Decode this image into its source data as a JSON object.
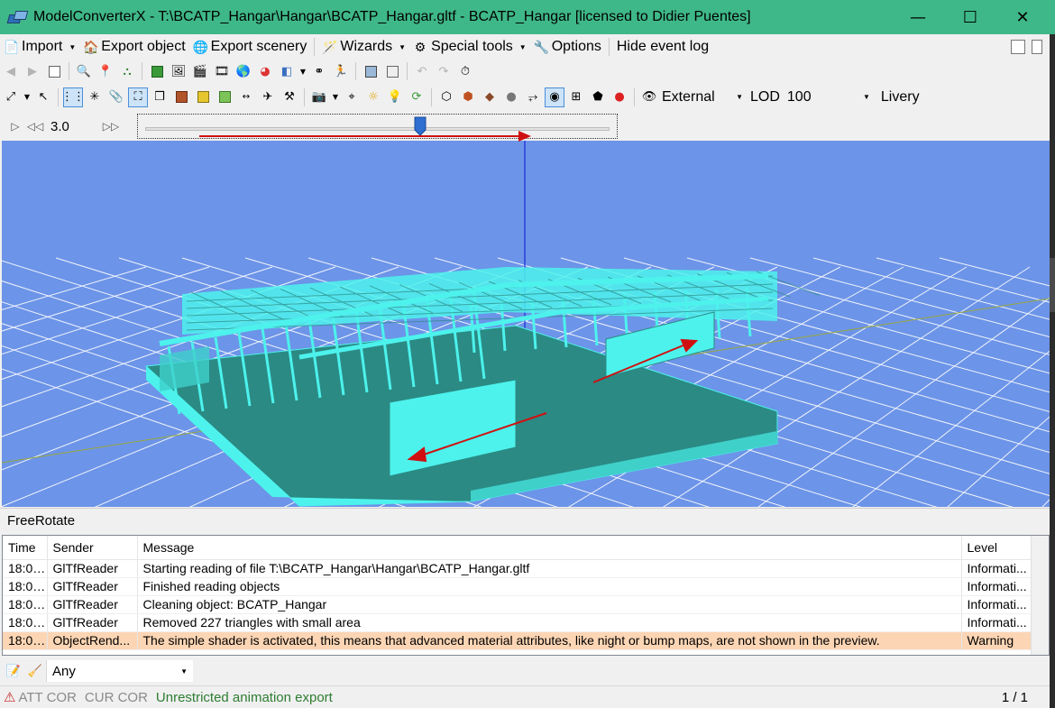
{
  "window": {
    "title": "ModelConverterX - T:\\BCATP_Hangar\\Hangar\\BCATP_Hangar.gltf - BCATP_Hangar [licensed to Didier Puentes]",
    "minimize_glyph": "—",
    "maximize_glyph": "☐",
    "close_glyph": "✕"
  },
  "menubar": {
    "import": "Import",
    "export_object": "Export object",
    "export_scenery": "Export scenery",
    "wizards": "Wizards",
    "special_tools": "Special tools",
    "options": "Options",
    "hide_event_log": "Hide event log"
  },
  "toolbar2": {
    "view_mode": "External",
    "lod_label": "LOD",
    "lod_value": "100",
    "livery_label": "Livery"
  },
  "animation": {
    "speed": "3.0",
    "slider_position": 0.59
  },
  "viewport": {
    "mode_label": "FreeRotate",
    "background_color": "#6c94e8",
    "model_color": "#4df2ec"
  },
  "log": {
    "columns": [
      "Time",
      "Sender",
      "Message",
      "Level"
    ],
    "rows": [
      {
        "time": "18:06...",
        "sender": "GlTfReader",
        "message": "Starting reading of file T:\\BCATP_Hangar\\Hangar\\BCATP_Hangar.gltf",
        "level": "Informati..."
      },
      {
        "time": "18:06...",
        "sender": "GlTfReader",
        "message": "Finished reading objects",
        "level": "Informati..."
      },
      {
        "time": "18:06...",
        "sender": "GlTfReader",
        "message": "Cleaning object: BCATP_Hangar",
        "level": "Informati..."
      },
      {
        "time": "18:06...",
        "sender": "GlTfReader",
        "message": "Removed 227 triangles with small area",
        "level": "Informati..."
      },
      {
        "time": "18:06...",
        "sender": "ObjectRend...",
        "message": "The simple shader is activated, this means that advanced material attributes, like night or bump maps, are not shown in the preview.",
        "level": "Warning"
      }
    ]
  },
  "filter": {
    "selected": "Any"
  },
  "status": {
    "att_cor": "ATT COR",
    "cur_cor": "CUR COR",
    "message": "Unrestricted animation export",
    "pages": "1 / 1"
  }
}
